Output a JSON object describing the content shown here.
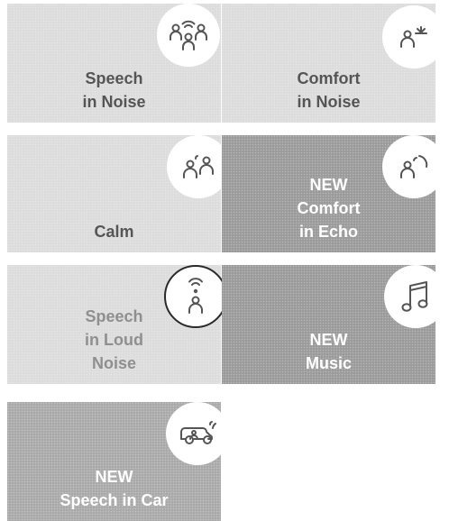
{
  "programs": [
    {
      "id": "speech-in-noise",
      "lines": [
        "Speech",
        "in Noise"
      ],
      "icon": "speech-in-noise-icon"
    },
    {
      "id": "comfort-in-noise",
      "lines": [
        "Comfort",
        "in Noise"
      ],
      "icon": "comfort-in-noise-icon"
    },
    {
      "id": "calm",
      "lines": [
        "Calm"
      ],
      "icon": "calm-icon"
    },
    {
      "id": "comfort-in-echo",
      "lines": [
        "NEW",
        "Comfort",
        "in Echo"
      ],
      "icon": "comfort-in-echo-icon"
    },
    {
      "id": "speech-in-loud-noise",
      "lines": [
        "Speech",
        "in Loud",
        "Noise"
      ],
      "icon": "speech-in-loud-noise-icon",
      "selected": true
    },
    {
      "id": "music",
      "lines": [
        "NEW",
        "Music"
      ],
      "icon": "music-note-icon"
    },
    {
      "id": "speech-in-car",
      "lines": [
        "NEW",
        "Speech in Car"
      ],
      "icon": "car-icon"
    }
  ],
  "colors": {
    "tile_light": "#dcdcdc",
    "tile_dark": "#9a9a9a",
    "text_dark": "#555555",
    "text_white": "#ffffff",
    "selected_border": "#2a2a2a"
  }
}
